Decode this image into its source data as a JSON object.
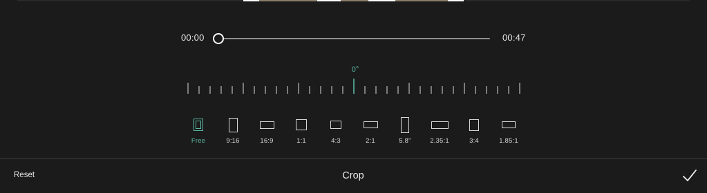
{
  "timeline": {
    "start_time": "00:00",
    "end_time": "00:47",
    "position": 0
  },
  "rotation": {
    "angle_label": "0°",
    "angle": 0
  },
  "aspect_ratios": [
    {
      "label": "Free",
      "selected": true,
      "icon": "free-crop-icon"
    },
    {
      "label": "9:16",
      "selected": false,
      "icon": "ratio-9-16-icon"
    },
    {
      "label": "16:9",
      "selected": false,
      "icon": "ratio-16-9-icon"
    },
    {
      "label": "1:1",
      "selected": false,
      "icon": "ratio-1-1-icon"
    },
    {
      "label": "4:3",
      "selected": false,
      "icon": "ratio-4-3-icon"
    },
    {
      "label": "2:1",
      "selected": false,
      "icon": "ratio-2-1-icon"
    },
    {
      "label": "5.8\"",
      "selected": false,
      "icon": "ratio-5-8-inch-icon"
    },
    {
      "label": "2.35:1",
      "selected": false,
      "icon": "ratio-2-35-1-icon"
    },
    {
      "label": "3:4",
      "selected": false,
      "icon": "ratio-3-4-icon"
    },
    {
      "label": "1.85:1",
      "selected": false,
      "icon": "ratio-1-85-1-icon"
    }
  ],
  "bottom_bar": {
    "reset_label": "Reset",
    "title": "Crop",
    "confirm_icon": "checkmark-icon"
  },
  "colors": {
    "accent": "#5bb7a4",
    "background": "#1b1b1b"
  }
}
